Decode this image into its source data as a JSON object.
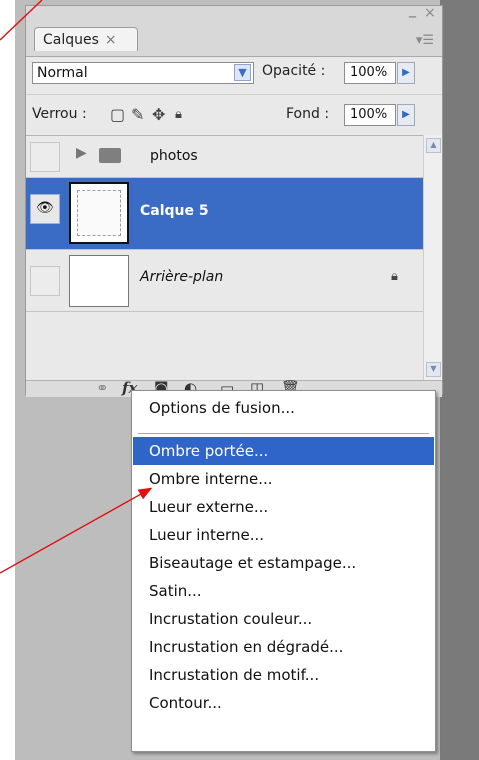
{
  "panel": {
    "tab_label": "Calques",
    "tab_close": "×",
    "minimize": "–",
    "close": "×",
    "panel_menu_icon": "panel-menu-icon"
  },
  "blend": {
    "mode_value": "Normal",
    "opacity_label": "Opacité :",
    "opacity_value": "100%"
  },
  "lock": {
    "label": "Verrou :",
    "fill_label": "Fond :",
    "fill_value": "100%"
  },
  "layers": [
    {
      "name": "photos",
      "type": "group",
      "visible": false
    },
    {
      "name": "Calque 5",
      "type": "layer",
      "visible": true,
      "selected": true
    },
    {
      "name": "Arrière-plan",
      "type": "background",
      "visible": false,
      "locked": true
    }
  ],
  "bottom_icons": [
    "link-icon",
    "fx-icon",
    "mask-icon",
    "adjustment-icon",
    "folder-icon",
    "new-layer-icon",
    "trash-icon"
  ],
  "fx_label": "fx",
  "context_menu": {
    "items": [
      "Options de fusion...",
      "Ombre portée...",
      "Ombre interne...",
      "Lueur externe...",
      "Lueur interne...",
      "Biseautage et estampage...",
      "Satin...",
      "Incrustation couleur...",
      "Incrustation en dégradé...",
      "Incrustation de motif...",
      "Contour..."
    ],
    "highlighted_index": 1
  },
  "colors": {
    "selection": "#3a6cc6",
    "arrow": "#e01010"
  }
}
